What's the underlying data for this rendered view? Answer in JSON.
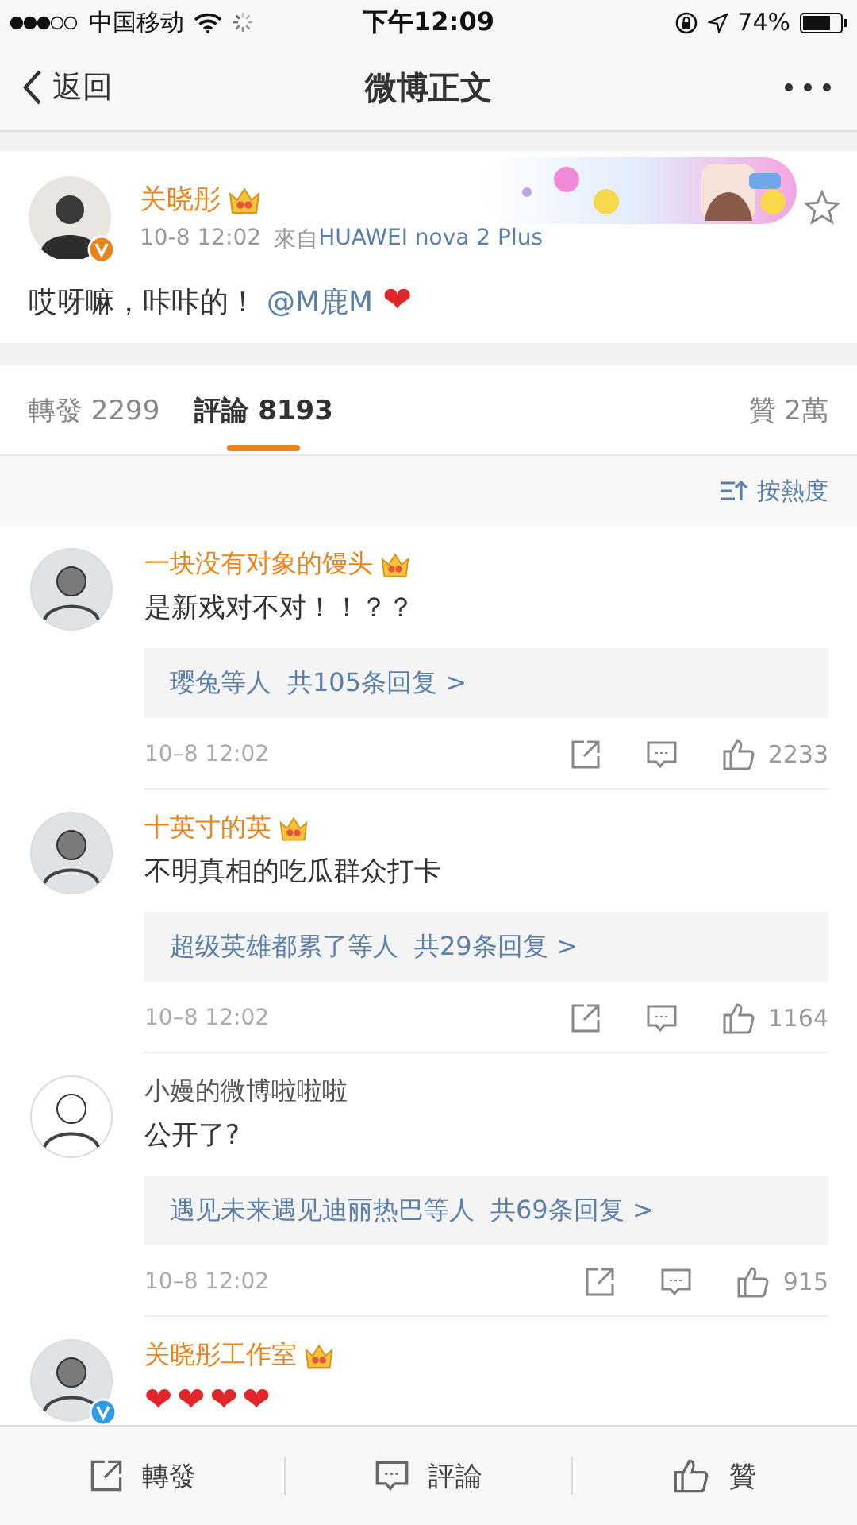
{
  "status_bar": {
    "carrier": "中国移动",
    "time": "下午12:09",
    "battery": "74%"
  },
  "nav": {
    "back": "返回",
    "title": "微博正文"
  },
  "post": {
    "author": "关晓彤",
    "vip": true,
    "verified": {
      "color": "#e8841a"
    },
    "time": "10-8 12:02",
    "source_prefix": "來自",
    "source": "HUAWEI nova 2 Plus",
    "favorited": false,
    "body": [
      {
        "kind": "text",
        "text": "哎呀嘛，咔咔的！"
      },
      {
        "kind": "mention",
        "text": "@M鹿M"
      },
      {
        "kind": "emoji",
        "text": "❤"
      }
    ]
  },
  "tabs": [
    {
      "label": "轉發 2299",
      "selected": false
    },
    {
      "label": "評論 8193",
      "selected": true
    },
    {
      "label": "贊 2萬",
      "selected": false
    }
  ],
  "sort": {
    "label": "按熱度"
  },
  "comments": [
    {
      "kind": "text",
      "name": "一块没有对象的馒头",
      "vip": true,
      "text": "是新戏对不对！！？？",
      "replies_who": "璎兔等人",
      "replies_count": "共105条回复 >",
      "time": "10–8 12:02",
      "likes": "2233"
    },
    {
      "kind": "text",
      "name": "十英寸的英",
      "vip": true,
      "text": "不明真相的吃瓜群众打卡",
      "replies_who": "超级英雄都累了等人",
      "replies_count": "共29条回复 >",
      "time": "10–8 12:02",
      "likes": "1164"
    },
    {
      "kind": "text",
      "name": "小嫚的微博啦啦啦",
      "vip": false,
      "text": "公开了?",
      "replies_who": "遇见未来遇见迪丽热巴等人",
      "replies_count": "共69条回复 >",
      "time": "10–8 12:02",
      "likes": "915"
    },
    {
      "kind": "emoji",
      "name": "关晓彤工作室",
      "vip": true,
      "verified": {
        "color": "#2f9be0"
      },
      "text": "❤❤❤❤"
    }
  ],
  "bottom_bar": [
    {
      "kind": "share",
      "label": "轉發"
    },
    {
      "kind": "comment",
      "label": "評論"
    },
    {
      "kind": "like",
      "label": "贊"
    }
  ]
}
